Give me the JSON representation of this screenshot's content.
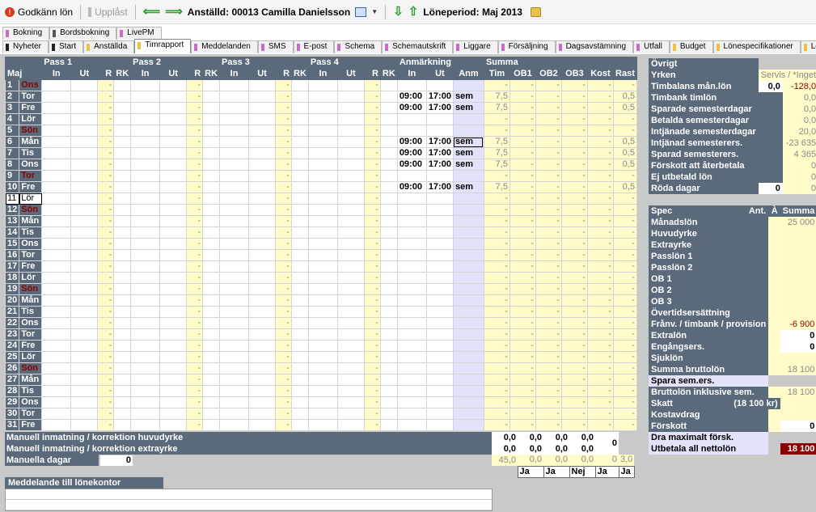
{
  "toolbar": {
    "approve": "Godkänn lön",
    "unlocked": "Upplåst",
    "employee": "Anställd: 00013 Camilla Danielsson",
    "period": "Löneperiod: Maj 2013"
  },
  "tabs_top": [
    "Bokning",
    "Bordsbokning",
    "LivePM"
  ],
  "tabs_main": [
    "Nyheter",
    "Start",
    "Anställda",
    "Timrapport",
    "Meddelanden",
    "SMS",
    "E-post",
    "Schema",
    "Schemautskrift",
    "Liggare",
    "Försäljning",
    "Dagsavstämning",
    "Utfall",
    "Budget",
    "Lönespecifikationer",
    "Lönelista"
  ],
  "active_tab": "Timrapport",
  "colors": {
    "header": "#5a6a7a",
    "yellow": "#fffcc9",
    "lavender": "#e2e2fb",
    "dark_red": "#8b0000"
  },
  "grid": {
    "group_headers": [
      "Pass 1",
      "Pass 2",
      "Pass 3",
      "Pass 4",
      "Anmärkning",
      "Summa"
    ],
    "month": "Maj",
    "pass_cols": [
      "In",
      "Ut",
      "R",
      "RK"
    ],
    "anm_cols": [
      "In",
      "Ut",
      "Anm"
    ],
    "sum_cols": [
      "Tim",
      "OB1",
      "OB2",
      "OB3",
      "Kost",
      "Rast"
    ],
    "days": [
      {
        "n": "1",
        "d": "Ons",
        "red": true
      },
      {
        "n": "2",
        "d": "Tor"
      },
      {
        "n": "3",
        "d": "Fre"
      },
      {
        "n": "4",
        "d": "Lör"
      },
      {
        "n": "5",
        "d": "Sön",
        "red": true
      },
      {
        "n": "6",
        "d": "Mån"
      },
      {
        "n": "7",
        "d": "Tis"
      },
      {
        "n": "8",
        "d": "Ons"
      },
      {
        "n": "9",
        "d": "Tor",
        "red": true
      },
      {
        "n": "10",
        "d": "Fre"
      },
      {
        "n": "11",
        "d": "Lör",
        "sel": true
      },
      {
        "n": "12",
        "d": "Sön",
        "red": true
      },
      {
        "n": "13",
        "d": "Mån"
      },
      {
        "n": "14",
        "d": "Tis"
      },
      {
        "n": "15",
        "d": "Ons"
      },
      {
        "n": "16",
        "d": "Tor"
      },
      {
        "n": "17",
        "d": "Fre"
      },
      {
        "n": "18",
        "d": "Lör"
      },
      {
        "n": "19",
        "d": "Sön",
        "red": true
      },
      {
        "n": "20",
        "d": "Mån"
      },
      {
        "n": "21",
        "d": "Tis"
      },
      {
        "n": "22",
        "d": "Ons"
      },
      {
        "n": "23",
        "d": "Tor"
      },
      {
        "n": "24",
        "d": "Fre"
      },
      {
        "n": "25",
        "d": "Lör"
      },
      {
        "n": "26",
        "d": "Sön",
        "red": true
      },
      {
        "n": "27",
        "d": "Mån"
      },
      {
        "n": "28",
        "d": "Tis"
      },
      {
        "n": "29",
        "d": "Ons"
      },
      {
        "n": "30",
        "d": "Tor"
      },
      {
        "n": "31",
        "d": "Fre"
      }
    ],
    "work_days": [
      "2",
      "3",
      "6",
      "7",
      "8",
      "10"
    ],
    "work": {
      "in": "09:00",
      "out": "17:00",
      "anm": "sem",
      "tim": "7,5",
      "rast": "0,5"
    },
    "focused_anm_day": "6"
  },
  "bottom": {
    "manual_main": "Manuell inmatning / korrektion huvudyrke",
    "manual_extra": "Manuell inmatning / korrektion extrayrke",
    "manual_days": "Manuella dagar",
    "manual_days_value": "0",
    "zero": "0,0",
    "kost_manual": "0",
    "totals": [
      "45,0",
      "0,0",
      "0,0",
      "0,0",
      "0",
      "3,0"
    ],
    "flags": [
      "Ja",
      "Ja",
      "Nej",
      "Ja",
      "Ja"
    ]
  },
  "message": {
    "title": "Meddelande till lönekontor"
  },
  "ovrigt": {
    "title": "Övrigt",
    "yrken_label": "Yrken",
    "yrken_value": "Servis / *Inget",
    "rows": [
      {
        "label": "Timbalans mån.lön",
        "v1": "0,0",
        "v2": "-128,0",
        "v2red": true
      },
      {
        "label": "Timbank timlön",
        "v2": "0,0"
      },
      {
        "label": "Sparade semesterdagar",
        "v2": "0,0"
      },
      {
        "label": "Betalda semesterdagar",
        "v2": "0,0"
      },
      {
        "label": "Intjänade semesterdagar",
        "v2": "20,0"
      },
      {
        "label": "Intjänad semesterers.",
        "v2": "-23 635"
      },
      {
        "label": "Sparad semesterers.",
        "v2": "4 365"
      },
      {
        "label": "Förskott att återbetala",
        "v2": "0"
      },
      {
        "label": "Ej utbetald lön",
        "v2": "0"
      },
      {
        "label": "Röda dagar",
        "v1": "0",
        "v2": "0"
      }
    ]
  },
  "spec": {
    "headers": [
      "Spec",
      "Ant.",
      "À",
      "Summa"
    ],
    "rows": [
      {
        "label": "Månadslön",
        "sum": "25 000"
      },
      {
        "label": "Huvudyrke"
      },
      {
        "label": "Extrayrke"
      },
      {
        "label": "Passlön 1"
      },
      {
        "label": "Passlön 2"
      },
      {
        "label": "OB 1"
      },
      {
        "label": "OB 2"
      },
      {
        "label": "OB 3"
      },
      {
        "label": "Övertidsersättning"
      },
      {
        "label": "Frånv. / timbank / provision",
        "sum": "-6 900",
        "red": true
      },
      {
        "label": "Extralön",
        "sum": "0",
        "white": true
      },
      {
        "label": "Engångsers.",
        "sum": "0",
        "white": true
      },
      {
        "label": "Sjuklön"
      },
      {
        "label": "Summa bruttolön",
        "sum": "18 100"
      },
      {
        "label": "Spara sem.ers."
      },
      {
        "label": "Bruttolön inklusive sem.",
        "sum": "18 100"
      },
      {
        "label": "Skatt",
        "sub": "(18 100 kr)"
      },
      {
        "label": "Kostavdrag"
      },
      {
        "label": "Förskott",
        "sum": "0",
        "white": true
      },
      {
        "label": "Dra maximalt försk."
      },
      {
        "label": "Utbetala all nettolön",
        "sum": "18 100",
        "total": true
      }
    ]
  }
}
